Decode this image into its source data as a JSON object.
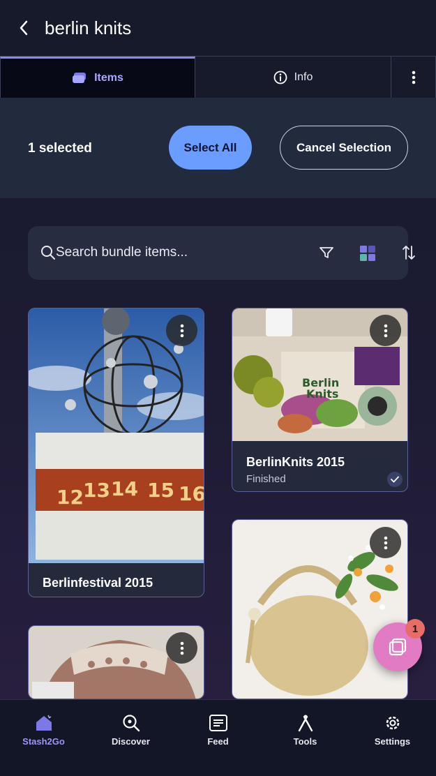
{
  "header": {
    "title": "berlin knits"
  },
  "tabs": [
    {
      "label": "Items",
      "icon": "stack-icon"
    },
    {
      "label": "Info",
      "icon": "info-icon"
    }
  ],
  "selection": {
    "count_label": "1 selected",
    "select_all_label": "Select All",
    "cancel_label": "Cancel Selection"
  },
  "search": {
    "placeholder": "Search bundle items..."
  },
  "cards": [
    {
      "title": "Berlinfestival 2015",
      "subtitle": "",
      "selected": false
    },
    {
      "title": "BerlinKnits 2015",
      "subtitle": "Finished",
      "selected": true
    },
    {
      "title": "",
      "subtitle": "",
      "selected": false
    },
    {
      "title": "",
      "subtitle": "",
      "selected": false
    }
  ],
  "fab": {
    "badge": "1",
    "icon": "layers-icon"
  },
  "nav": [
    {
      "label": "Stash2Go",
      "icon": "home-icon",
      "active": true
    },
    {
      "label": "Discover",
      "icon": "discover-icon",
      "active": false
    },
    {
      "label": "Feed",
      "icon": "feed-icon",
      "active": false
    },
    {
      "label": "Tools",
      "icon": "tools-icon",
      "active": false
    },
    {
      "label": "Settings",
      "icon": "settings-icon",
      "active": false
    }
  ],
  "colors": {
    "accent": "#6b9cff",
    "tab_active": "#a9a6ff",
    "fab": "#e07bc4",
    "badge": "#e86d66"
  }
}
